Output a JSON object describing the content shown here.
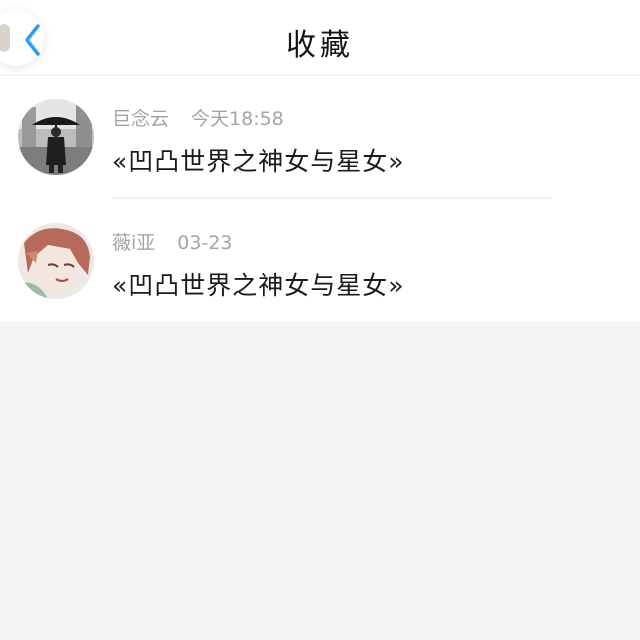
{
  "header": {
    "title": "收藏",
    "back_icon": "chevron-left-icon",
    "accent": "#2a9df4"
  },
  "favorites": [
    {
      "author": "巨念云",
      "time": "今天18:58",
      "title": "«凹凸世界之神女与星女»",
      "avatar": "avatar-umbrella-figure"
    },
    {
      "author": "薇i亚",
      "time": "03-23",
      "title": "«凹凸世界之神女与星女»",
      "avatar": "avatar-anime-red-hair"
    }
  ]
}
